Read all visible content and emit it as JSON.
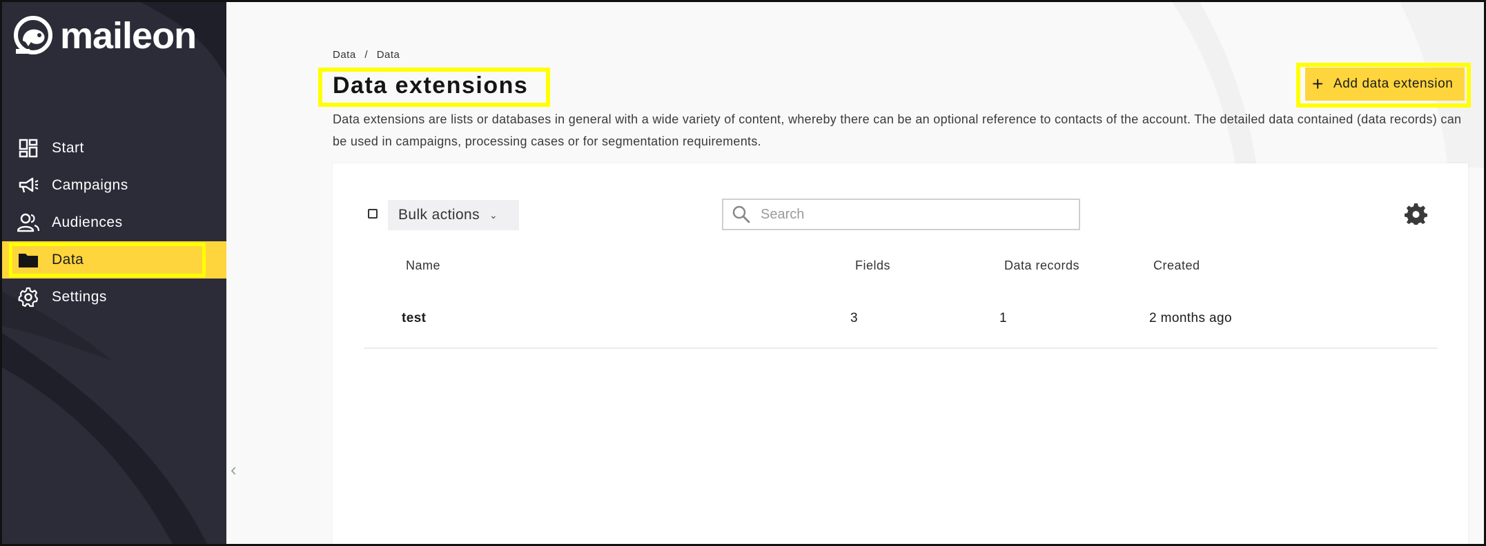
{
  "brand": {
    "name": "maileon",
    "accent": "#ffd53d",
    "sidebar_bg": "#2b2c38"
  },
  "sidebar": {
    "items": [
      {
        "label": "Start",
        "icon": "dashboard-icon",
        "active": false
      },
      {
        "label": "Campaigns",
        "icon": "megaphone-icon",
        "active": false
      },
      {
        "label": "Audiences",
        "icon": "people-icon",
        "active": false
      },
      {
        "label": "Data",
        "icon": "folder-icon",
        "active": true
      },
      {
        "label": "Settings",
        "icon": "gear-icon",
        "active": false
      }
    ]
  },
  "breadcrumb": [
    "Data",
    "Data"
  ],
  "breadcrumb_separator": "/",
  "page": {
    "title": "Data extensions",
    "description": "Data extensions are lists or databases in general with a wide variety of content, whereby there can be an optional reference to contacts of the account. The detailed data contained (data records) can be used in campaigns, processing cases or for segmentation requirements."
  },
  "actions": {
    "add_label": "Add data extension",
    "add_symbol": "+"
  },
  "toolbar": {
    "bulk_label": "Bulk actions",
    "bulk_chevron": "⌄",
    "search_placeholder": "Search"
  },
  "table": {
    "columns": [
      "Name",
      "Fields",
      "Data records",
      "Created"
    ],
    "rows": [
      {
        "name": "test",
        "fields": "3",
        "records": "1",
        "created": "2 months ago"
      }
    ]
  },
  "collapse_symbol": "‹"
}
